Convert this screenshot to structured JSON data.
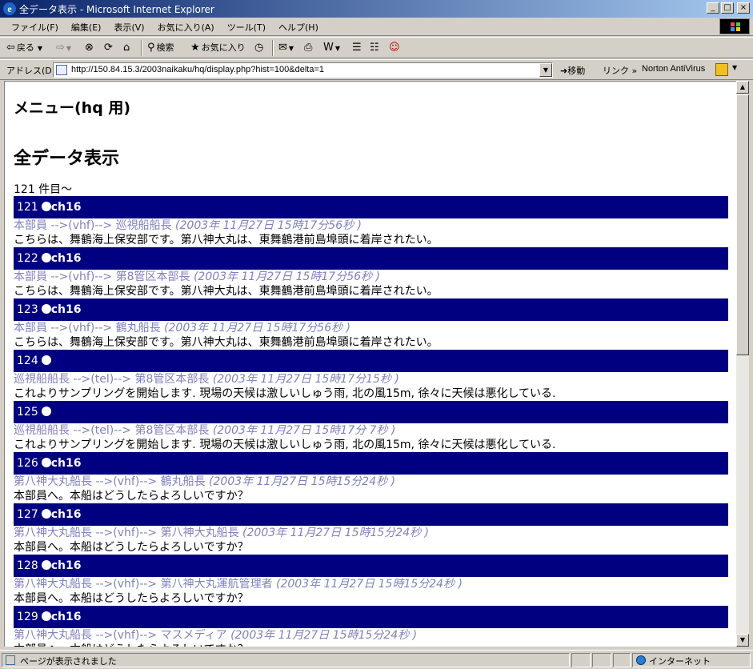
{
  "window": {
    "title": "全データ表示 - Microsoft Internet Explorer",
    "controls": {
      "minimize": "_",
      "maximize": "□",
      "close": "×"
    }
  },
  "menubar": {
    "items": [
      {
        "label": "ファイル(F)"
      },
      {
        "label": "編集(E)"
      },
      {
        "label": "表示(V)"
      },
      {
        "label": "お気に入り(A)"
      },
      {
        "label": "ツール(T)"
      },
      {
        "label": "ヘルプ(H)"
      }
    ]
  },
  "toolbar": {
    "back_label": "戻る",
    "search_label": "検索",
    "favorites_label": "お気に入り"
  },
  "addressbar": {
    "label": "アドレス(D)",
    "url": "http://150.84.15.3/2003naikaku/hq/display.php?hist=100&delta=1",
    "go_label": "移動",
    "links_label": "リンク »",
    "norton_label": "Norton AntiVirus"
  },
  "page": {
    "menu_title": "メニュー(hq 用)",
    "section_title": "全データ表示",
    "count_text": "121 件目～",
    "records": [
      {
        "num": "121",
        "channel": "ch16",
        "route": "本部員 -->(vhf)--> 巡視船船長",
        "timestamp": "(2003年 11月27日 15時17分56秒 )",
        "body": "こちらは、舞鶴海上保安部です。第八神大丸は、東舞鶴港前島埠頭に着岸されたい。"
      },
      {
        "num": "122",
        "channel": "ch16",
        "route": "本部員 -->(vhf)--> 第8管区本部長",
        "timestamp": "(2003年 11月27日 15時17分56秒 )",
        "body": "こちらは、舞鶴海上保安部です。第八神大丸は、東舞鶴港前島埠頭に着岸されたい。"
      },
      {
        "num": "123",
        "channel": "ch16",
        "route": "本部員 -->(vhf)--> 鶴丸船長",
        "timestamp": "(2003年 11月27日 15時17分56秒 )",
        "body": "こちらは、舞鶴海上保安部です。第八神大丸は、東舞鶴港前島埠頭に着岸されたい。"
      },
      {
        "num": "124",
        "channel": "",
        "route": "巡視船船長 -->(tel)--> 第8管区本部長",
        "timestamp": "(2003年 11月27日 15時17分15秒 )",
        "body": "これよりサンプリングを開始します. 現場の天候は激しいしゅう雨, 北の風15m, 徐々に天候は悪化している."
      },
      {
        "num": "125",
        "channel": "",
        "route": "巡視船船長 -->(tel)--> 第8管区本部長",
        "timestamp": "(2003年 11月27日 15時17分 7秒 )",
        "body": "これよりサンプリングを開始します. 現場の天候は激しいしゅう雨, 北の風15m, 徐々に天候は悪化している."
      },
      {
        "num": "126",
        "channel": "ch16",
        "route": "第八神大丸船長 -->(vhf)--> 鶴丸船長",
        "timestamp": "(2003年 11月27日 15時15分24秒 )",
        "body": "本部員へ。本船はどうしたらよろしいですか？"
      },
      {
        "num": "127",
        "channel": "ch16",
        "route": "第八神大丸船長 -->(vhf)--> 第八神大丸船長",
        "timestamp": "(2003年 11月27日 15時15分24秒 )",
        "body": "本部員へ。本船はどうしたらよろしいですか？"
      },
      {
        "num": "128",
        "channel": "ch16",
        "route": "第八神大丸船長 -->(vhf)--> 第八神大丸運航管理者",
        "timestamp": "(2003年 11月27日 15時15分24秒 )",
        "body": "本部員へ。本船はどうしたらよろしいですか？"
      },
      {
        "num": "129",
        "channel": "ch16",
        "route": "第八神大丸船長 -->(vhf)--> マスメディア",
        "timestamp": "(2003年 11月27日 15時15分24秒 )",
        "body": "本部員へ。本船はどうしたらよろしいですか？"
      }
    ]
  },
  "statusbar": {
    "text": "ページが表示されました",
    "zone": "インターネット"
  },
  "colors": {
    "header_bg": "#000080",
    "route_text": "#8080c0",
    "chrome": "#d4d0c8"
  }
}
